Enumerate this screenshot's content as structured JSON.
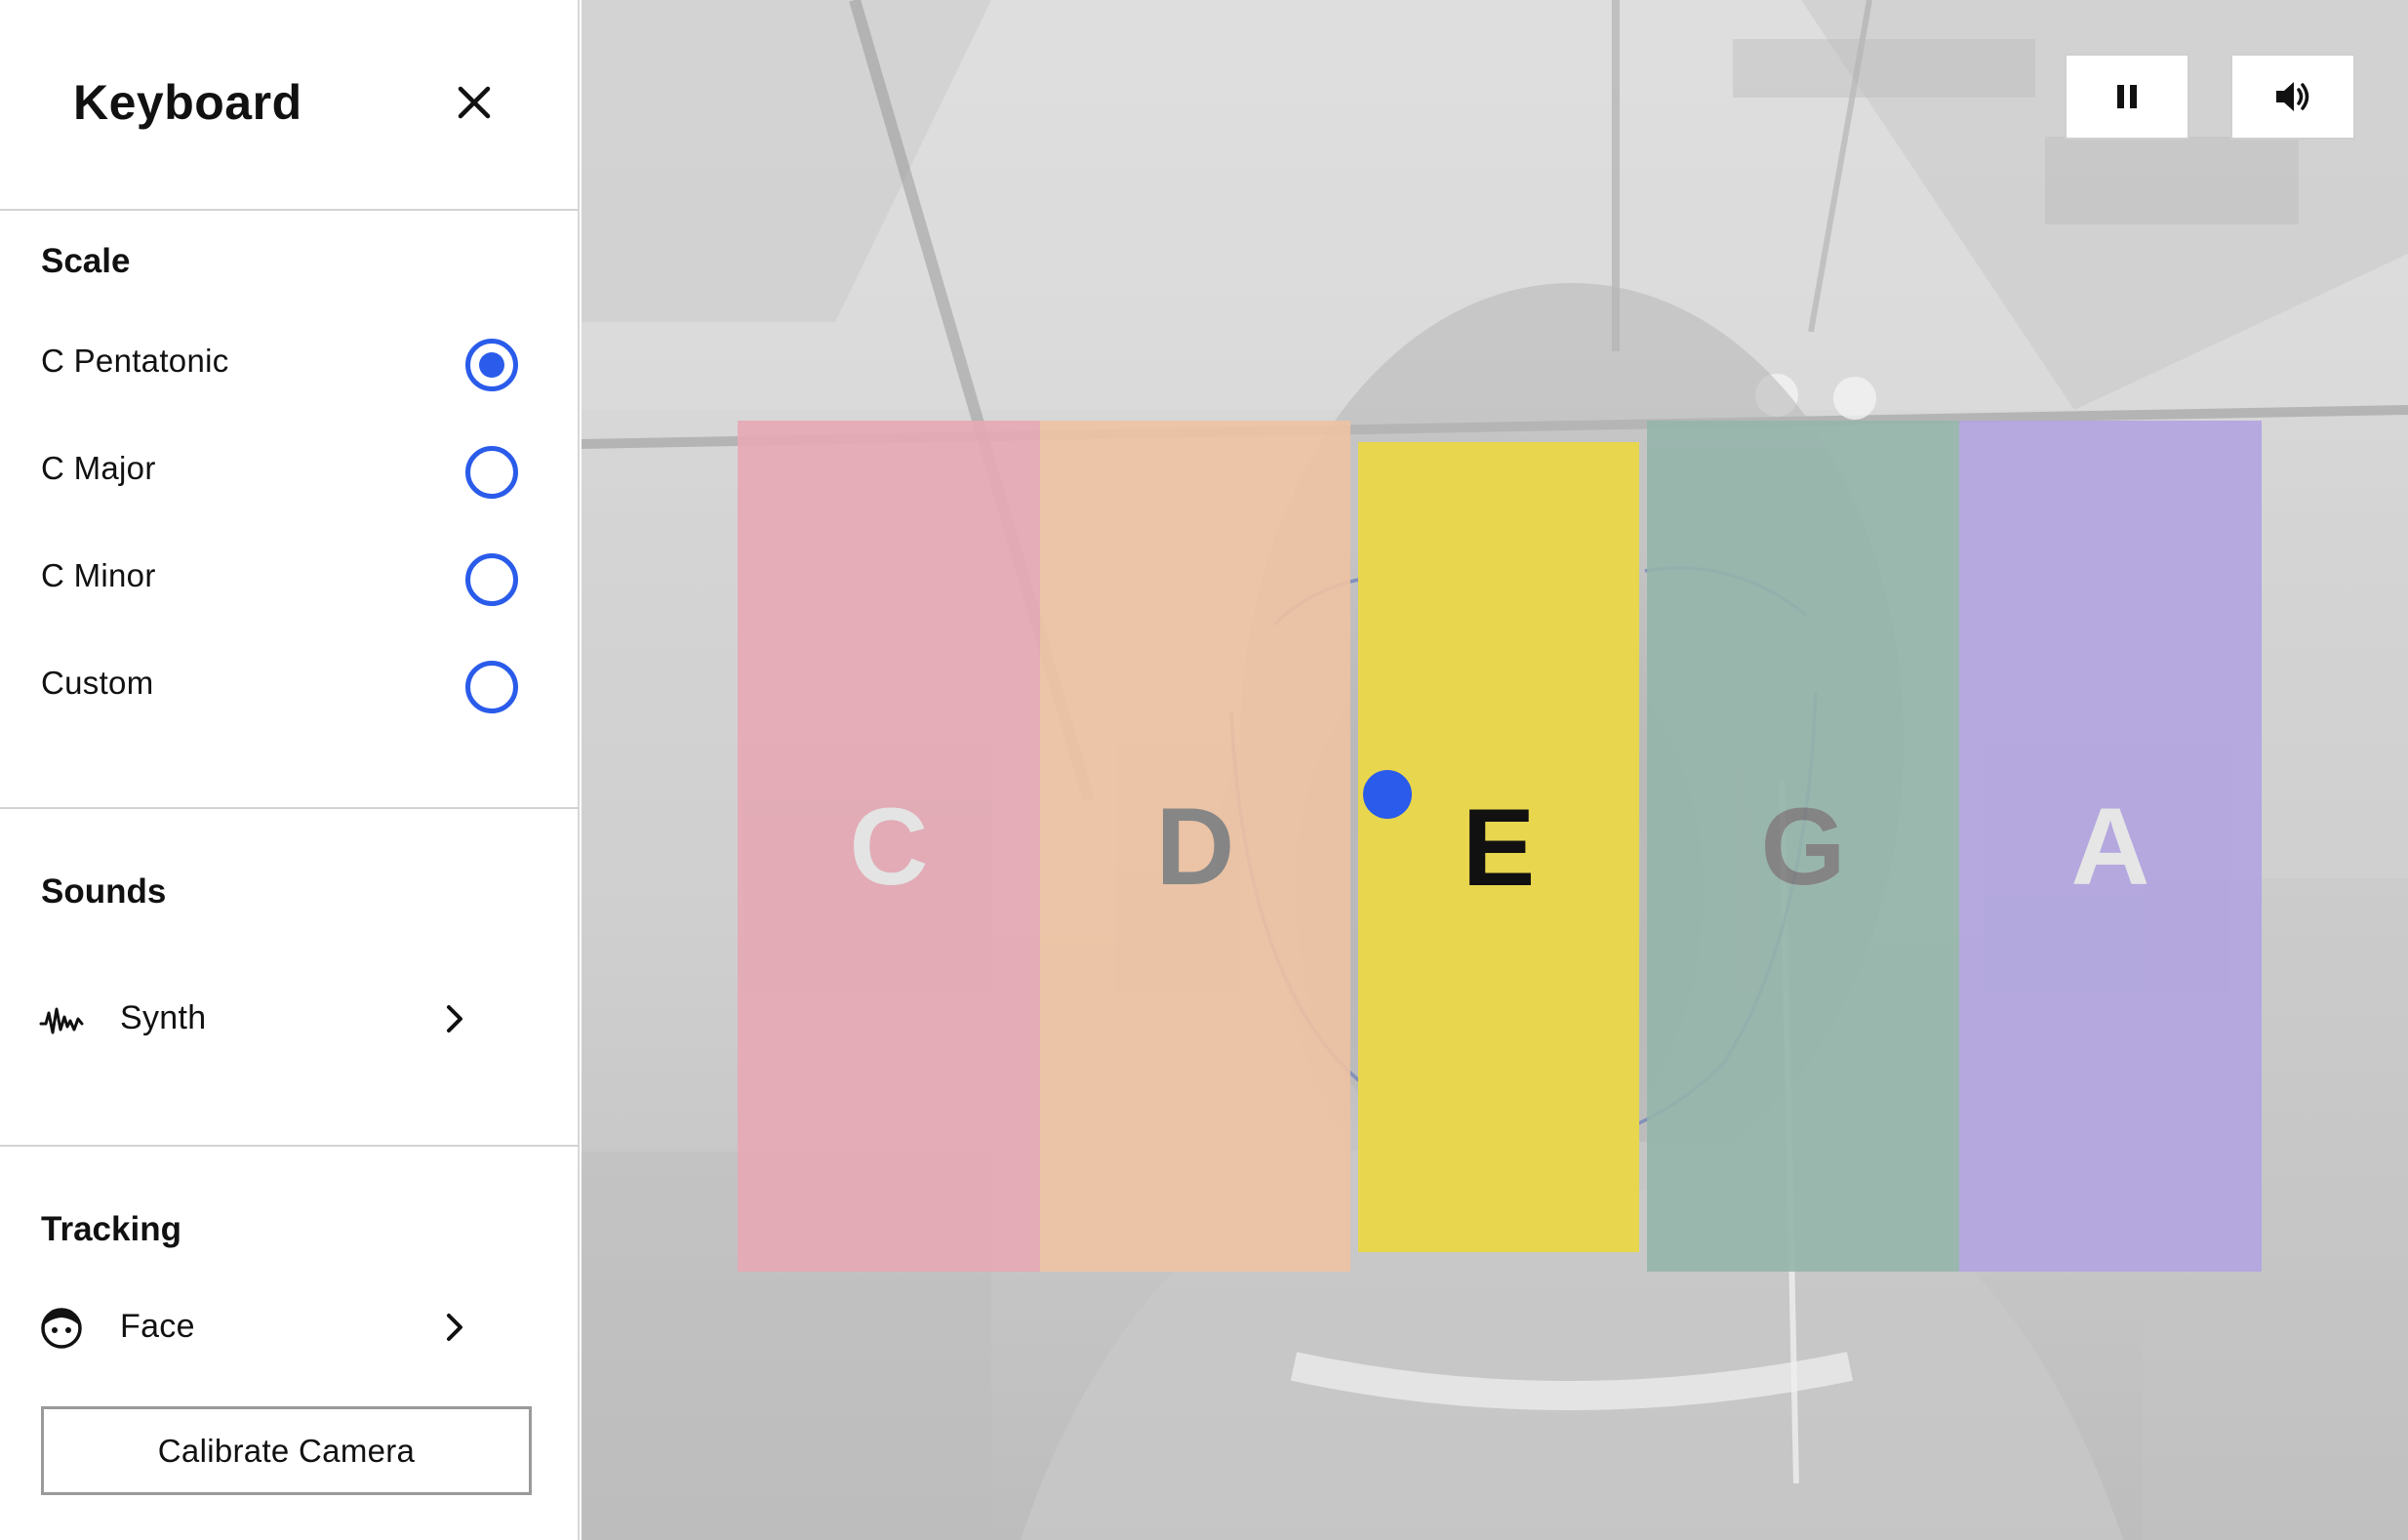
{
  "panel": {
    "title": "Keyboard",
    "close_icon": "close-icon"
  },
  "scale": {
    "heading": "Scale",
    "options": [
      {
        "label": "C Pentatonic",
        "selected": true
      },
      {
        "label": "C Major",
        "selected": false
      },
      {
        "label": "C Minor",
        "selected": false
      },
      {
        "label": "Custom",
        "selected": false
      }
    ]
  },
  "sounds": {
    "heading": "Sounds",
    "item": {
      "label": "Synth",
      "icon": "waveform-icon"
    }
  },
  "tracking": {
    "heading": "Tracking",
    "item": {
      "label": "Face",
      "icon": "face-icon"
    },
    "calibrate_label": "Calibrate Camera"
  },
  "controls": {
    "pause_icon": "pause-icon",
    "volume_icon": "volume-icon"
  },
  "keys": [
    {
      "note": "C",
      "color": "#e5a8b4",
      "text_color": "#e7e7e7",
      "active": false
    },
    {
      "note": "D",
      "color": "#eec2a2",
      "text_color": "#7e7e7e",
      "active": false
    },
    {
      "note": "E",
      "color": "#e8d64e",
      "text_color": "#111111",
      "active": true
    },
    {
      "note": "G",
      "color": "#95b5ab",
      "text_color": "#7e7e7e",
      "active": false
    },
    {
      "note": "A",
      "color": "#b1a4e0",
      "text_color": "#e9e9e9",
      "active": false
    }
  ],
  "colors": {
    "accent": "#2a5bea"
  }
}
